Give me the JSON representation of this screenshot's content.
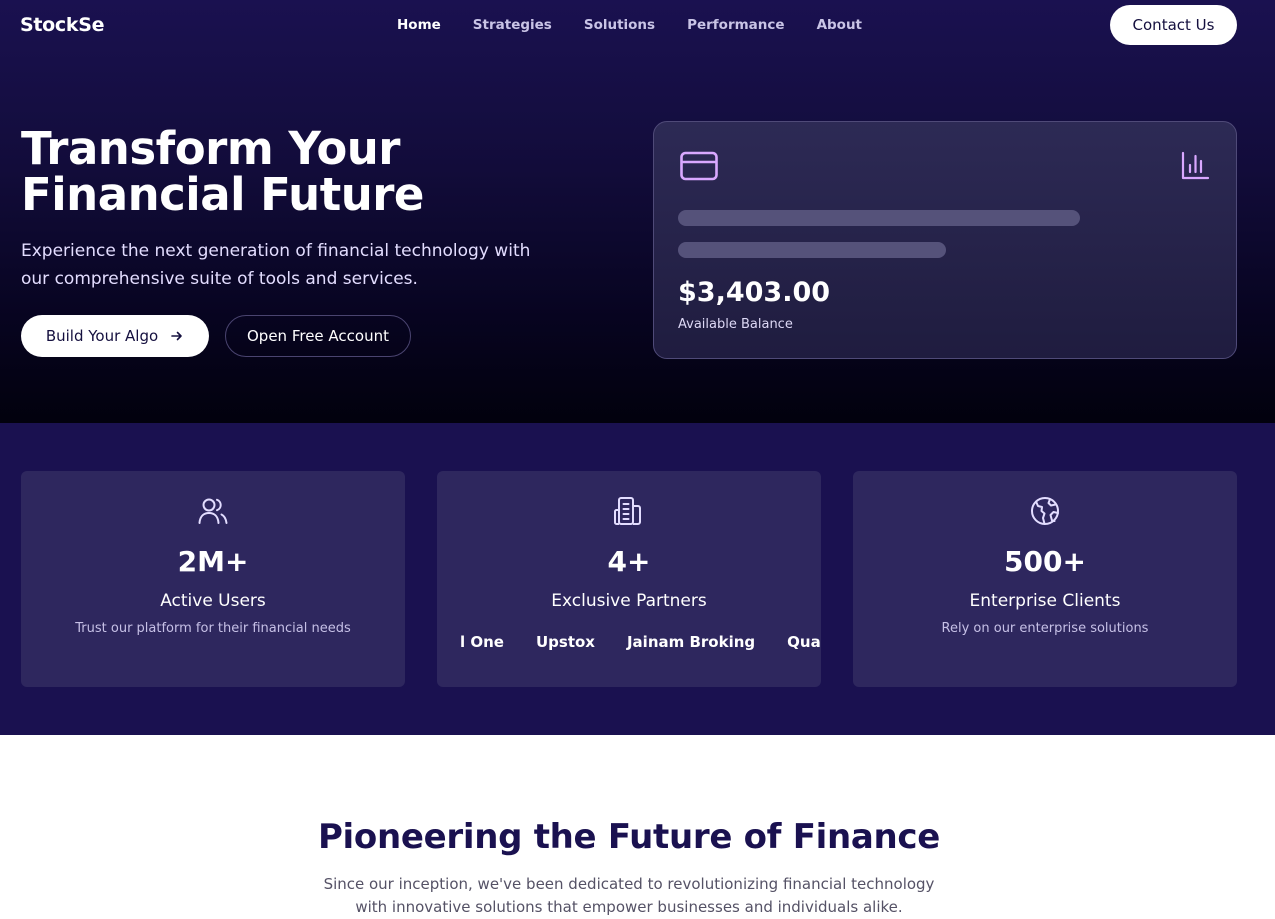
{
  "nav": {
    "logo": "StockSe",
    "links": [
      {
        "label": "Home",
        "active": true
      },
      {
        "label": "Strategies",
        "active": false
      },
      {
        "label": "Solutions",
        "active": false
      },
      {
        "label": "Performance",
        "active": false
      },
      {
        "label": "About",
        "active": false
      }
    ],
    "contact_label": "Contact Us"
  },
  "hero": {
    "title_line1": "Transform Your",
    "title_line2": "Financial Future",
    "subtitle": "Experience the next generation of financial technology with our comprehensive suite of tools and services.",
    "primary_button": "Build Your Algo",
    "primary_button_icon": "arrow-right-icon",
    "secondary_button": "Open Free Account"
  },
  "balance_card": {
    "card_icon": "credit-card-icon",
    "chart_icon": "bar-chart-icon",
    "amount": "$3,403.00",
    "label": "Available Balance"
  },
  "stats": [
    {
      "icon": "users-icon",
      "value": "2M+",
      "title": "Active Users",
      "description": "Trust our platform for their financial needs"
    },
    {
      "icon": "building-icon",
      "value": "4+",
      "title": "Exclusive Partners",
      "partners": [
        "l One",
        "Upstox",
        "Jainam Broking",
        "Qua"
      ]
    },
    {
      "icon": "globe-icon",
      "value": "500+",
      "title": "Enterprise Clients",
      "description": "Rely on our enterprise solutions"
    }
  ],
  "about": {
    "title": "Pioneering the Future of Finance",
    "subtitle": "Since our inception, we've been dedicated to revolutionizing financial technology with innovative solutions that empower businesses and individuals alike."
  },
  "colors": {
    "navy": "#1a1150",
    "card": "#2e275e",
    "accent_violet": "#d9a8ff",
    "white": "#ffffff"
  }
}
